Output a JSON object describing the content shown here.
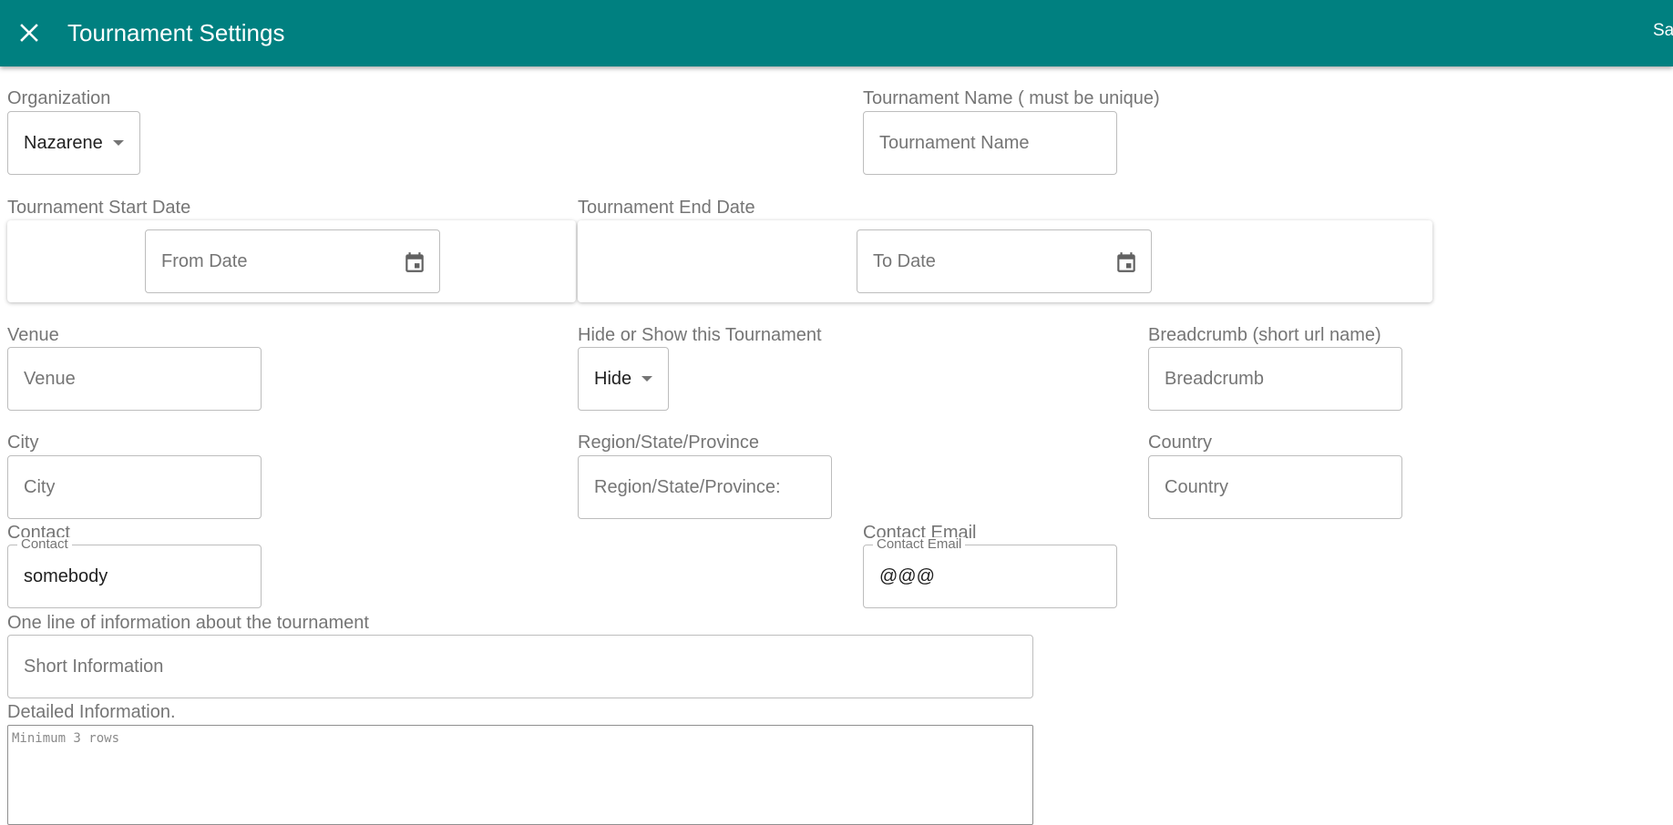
{
  "toolbar": {
    "title": "Tournament Settings",
    "save_label": "Save",
    "close_icon": "close-icon",
    "color": "#008080"
  },
  "form": {
    "organization": {
      "label": "Organization",
      "value": "Nazarene"
    },
    "tournament_name": {
      "label": "Tournament Name ( must be unique)",
      "placeholder": "Tournament Name"
    },
    "start_date": {
      "label": "Tournament Start Date",
      "placeholder": "From Date",
      "icon": "calendar-icon"
    },
    "end_date": {
      "label": "Tournament End Date",
      "placeholder": "To Date",
      "icon": "calendar-icon"
    },
    "venue": {
      "label": "Venue",
      "placeholder": "Venue"
    },
    "visibility": {
      "label": "Hide or Show this Tournament",
      "value": "Hide"
    },
    "breadcrumb": {
      "label": "Breadcrumb (short url name)",
      "placeholder": "Breadcrumb"
    },
    "city": {
      "label": "City",
      "placeholder": "City"
    },
    "region": {
      "label": "Region/State/Province",
      "placeholder": "Region/State/Province:"
    },
    "country": {
      "label": "Country",
      "placeholder": "Country"
    },
    "contact": {
      "label": "Contact",
      "legend": "Contact",
      "value": "somebody"
    },
    "contact_email": {
      "label": "Contact Email",
      "legend": "Contact Email",
      "value": "@@@"
    },
    "short_info": {
      "label": "One line of information about the tournament",
      "placeholder": "Short Information"
    },
    "detailed_info": {
      "label": "Detailed Information.",
      "placeholder": "Minimum 3 rows"
    }
  }
}
